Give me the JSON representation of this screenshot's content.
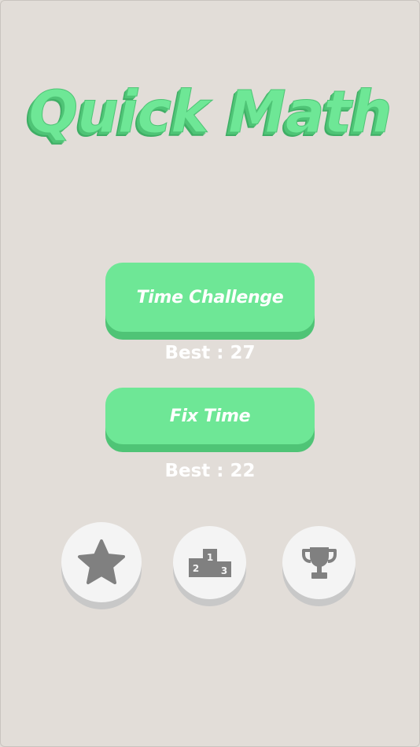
{
  "app": {
    "title": "Quick Math"
  },
  "modes": [
    {
      "label": "Time Challenge",
      "best": "Best : 27"
    },
    {
      "label": "Fix Time",
      "best": "Best : 22"
    }
  ],
  "actions": {
    "rate_icon": "star-icon",
    "leaderboard_icon": "podium-icon",
    "achievements_icon": "trophy-icon",
    "podium_digits": [
      "1",
      "2",
      "3"
    ]
  },
  "colors": {
    "background": "#e2ddd8",
    "accent": "#6ee796",
    "accent_shadow": "#4fc476",
    "icon_gray": "#808080"
  }
}
